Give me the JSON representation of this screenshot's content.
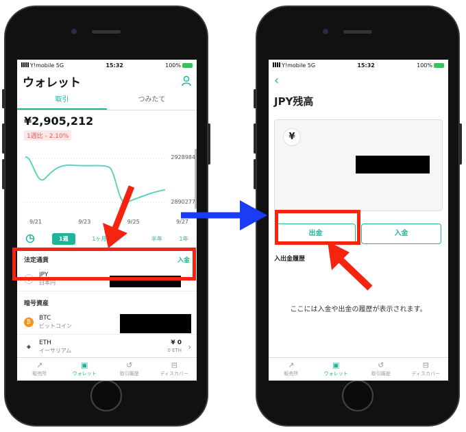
{
  "status": {
    "carrier": "Y!mobile",
    "network": "5G",
    "time": "15:32",
    "battery": "100%"
  },
  "wallet": {
    "title": "ウォレット",
    "tabs": [
      {
        "label": "取引"
      },
      {
        "label": "つみたて"
      }
    ],
    "balance": "¥2,905,212",
    "change": "1週比 - 2.10%",
    "chart": {
      "y_high": "2928984",
      "y_low": "2890277",
      "x_labels": [
        "9/21",
        "9/23",
        "9/25",
        "9/27"
      ]
    },
    "ranges": [
      "1週",
      "1ヶ月",
      "半年",
      "1年"
    ],
    "fiat_title": "法定通貨",
    "deposit_link": "入金",
    "jpy": {
      "code": "JPY",
      "name": "日本円"
    },
    "crypto_title": "暗号資産",
    "btc": {
      "code": "BTC",
      "name": "ビットコイン"
    },
    "eth": {
      "code": "ETH",
      "name": "イーサリアム",
      "amount": "¥ 0",
      "qty": "0 ETH"
    }
  },
  "jpy_screen": {
    "title": "JPY残高",
    "withdraw": "出金",
    "deposit": "入金",
    "history_title": "入出金履歴",
    "empty": "ここには入金や出金の履歴が表示されます。"
  },
  "tabbar": [
    "販売所",
    "ウォレット",
    "取引履歴",
    "ディスカバー"
  ],
  "colors": {
    "accent": "#1fb59a",
    "highlight": "#f52410",
    "arrow_blue": "#1a3cf5"
  }
}
